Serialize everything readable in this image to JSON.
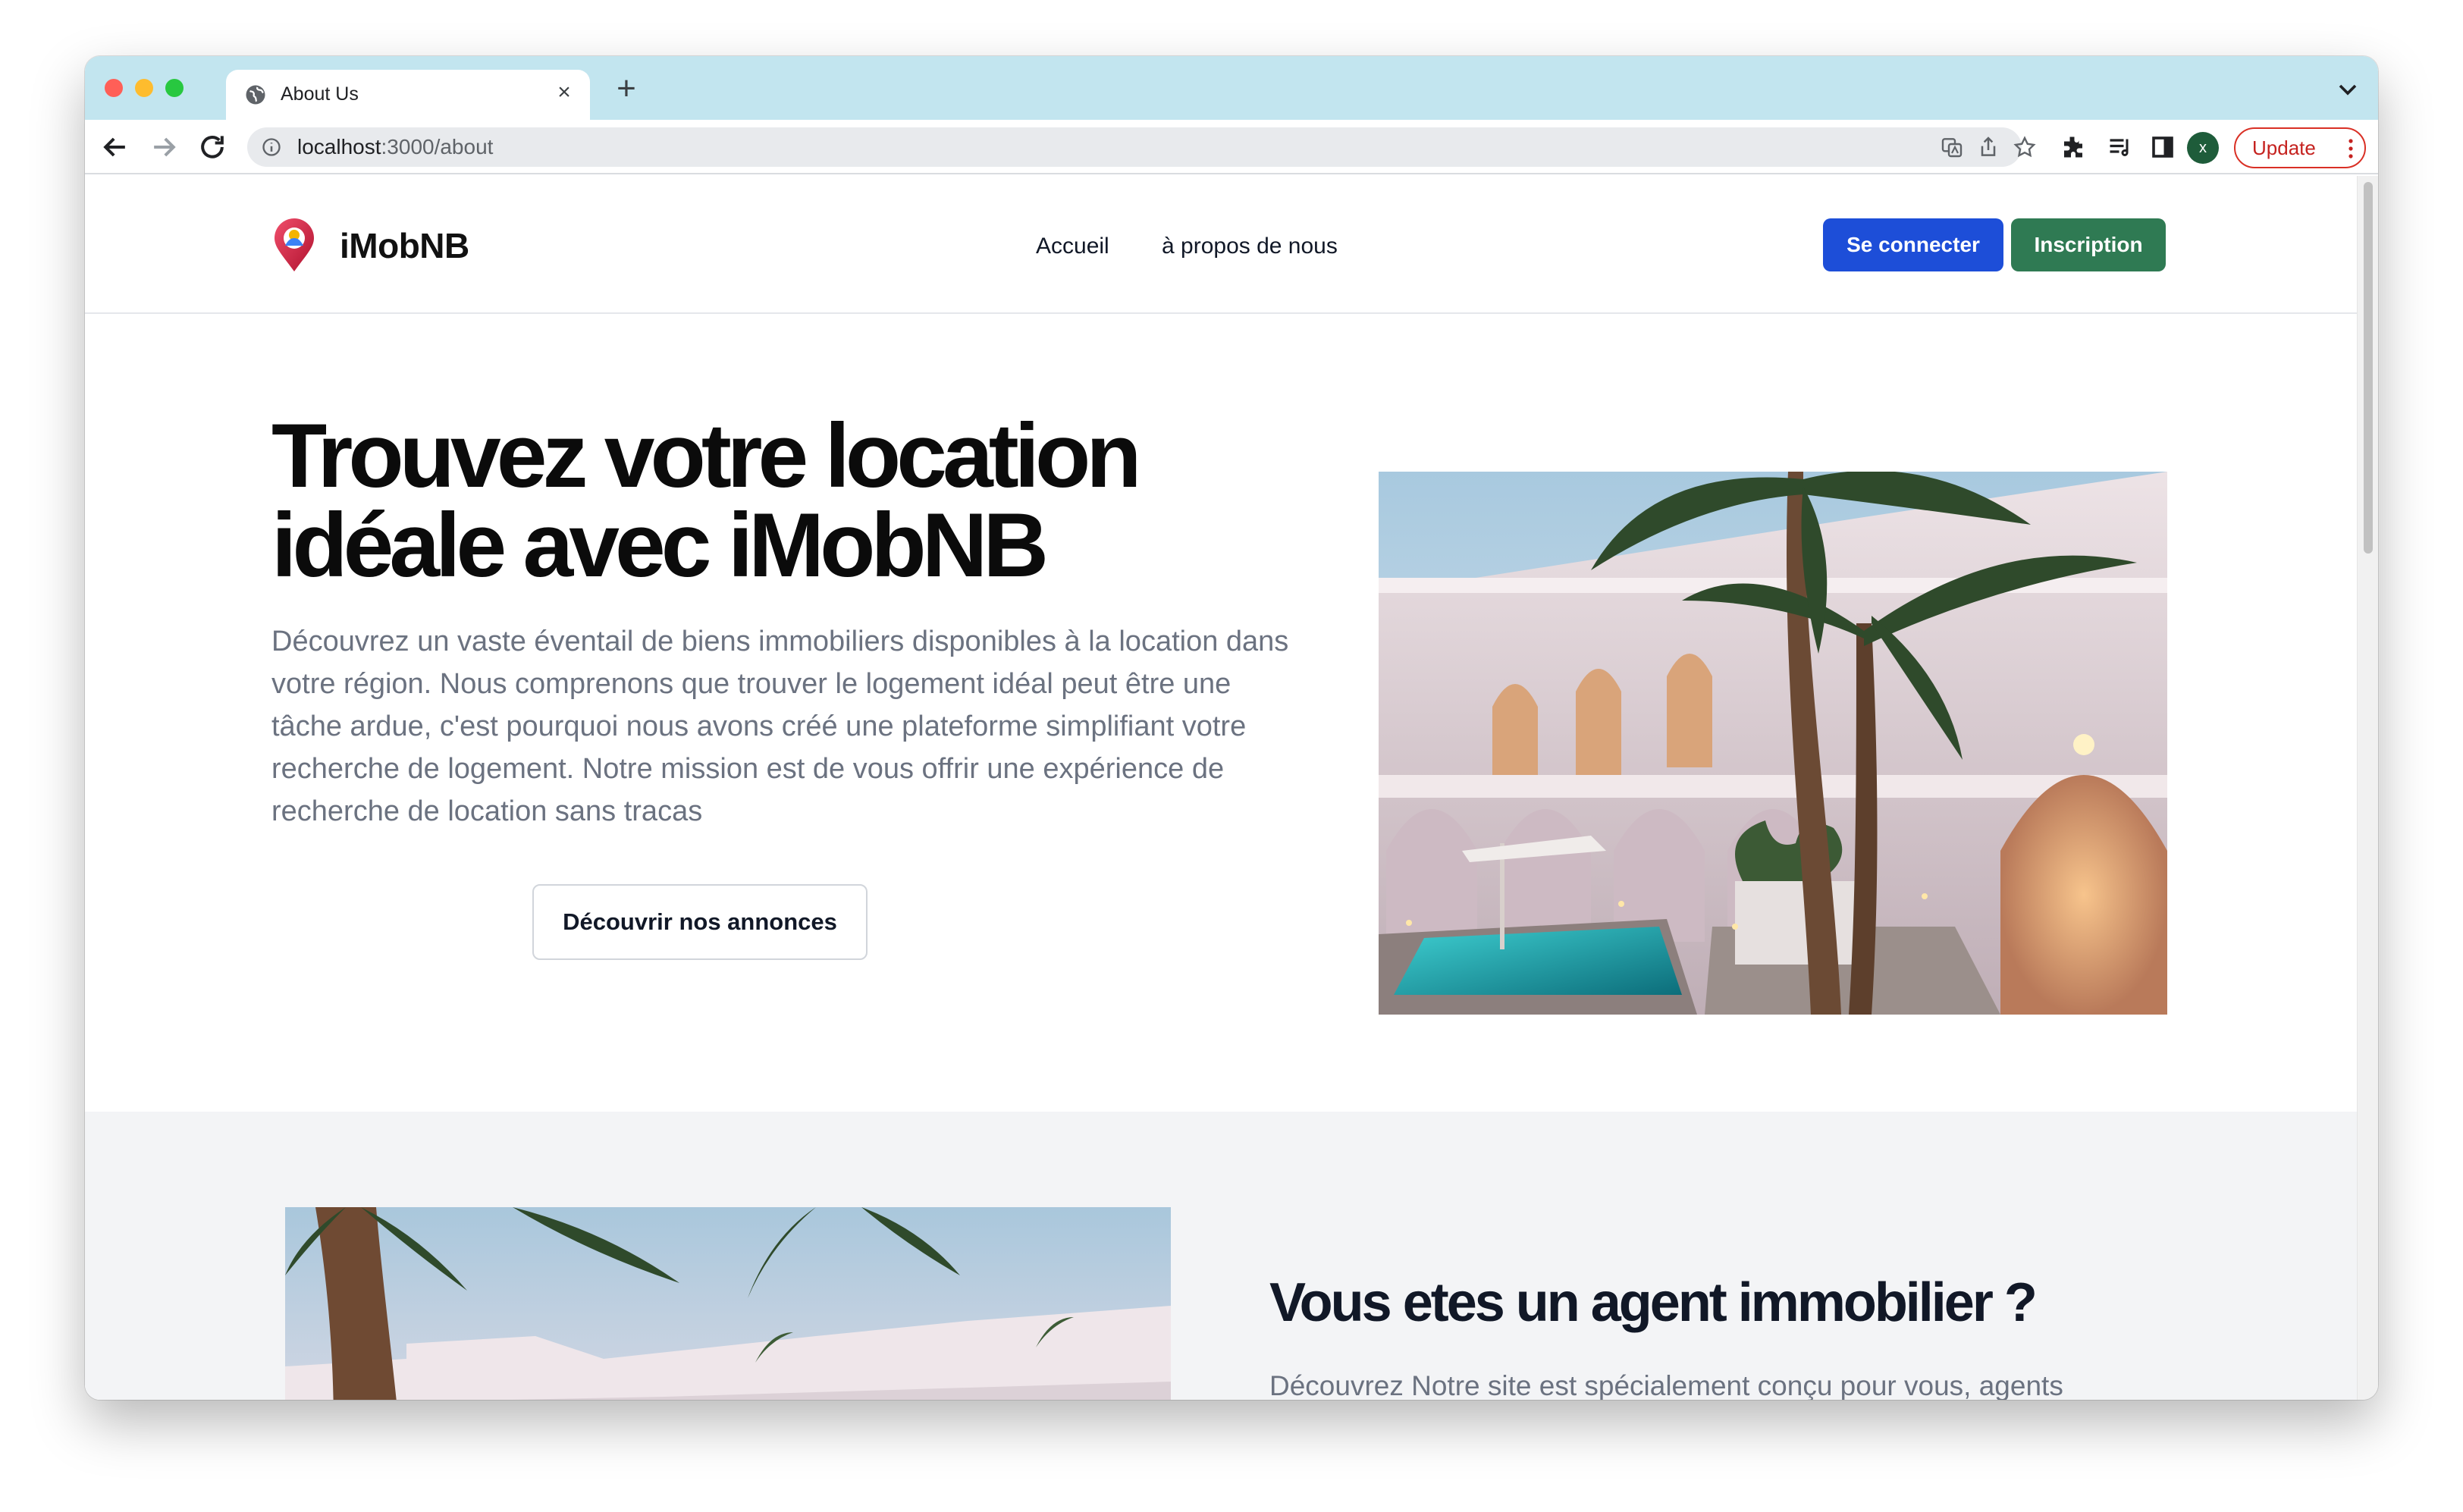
{
  "browser": {
    "tab_title": "About Us",
    "url_host": "localhost",
    "url_path": ":3000/about",
    "profile_initial": "x",
    "update_label": "Update",
    "colors": {
      "tabstrip": "#c2e5ef",
      "update_red": "#d93025"
    }
  },
  "header": {
    "brand": "iMobNB",
    "nav": [
      "Accueil",
      "à propos de nous"
    ],
    "login_label": "Se connecter",
    "signup_label": "Inscription",
    "colors": {
      "login": "#1d4ed8",
      "signup": "#2f7a53"
    }
  },
  "hero": {
    "title": "Trouvez votre location idéale avec iMobNB",
    "text": "Découvrez un vaste éventail de biens immobiliers disponibles à la location dans votre région. Nous comprenons que trouver le logement idéal peut être une tâche ardue, c'est pourquoi nous avons créé une plateforme simplifiant votre recherche de logement. Notre mission est de vous offrir une expérience de recherche de location sans tracas",
    "cta_label": "Découvrir nos annonces"
  },
  "agents": {
    "title": "Vous etes un agent immobilier ?",
    "text": "Découvrez Notre site est spécialement conçu pour vous, agents immobiliers. Nous comprenons les défis que vous rencontrez dans le"
  }
}
